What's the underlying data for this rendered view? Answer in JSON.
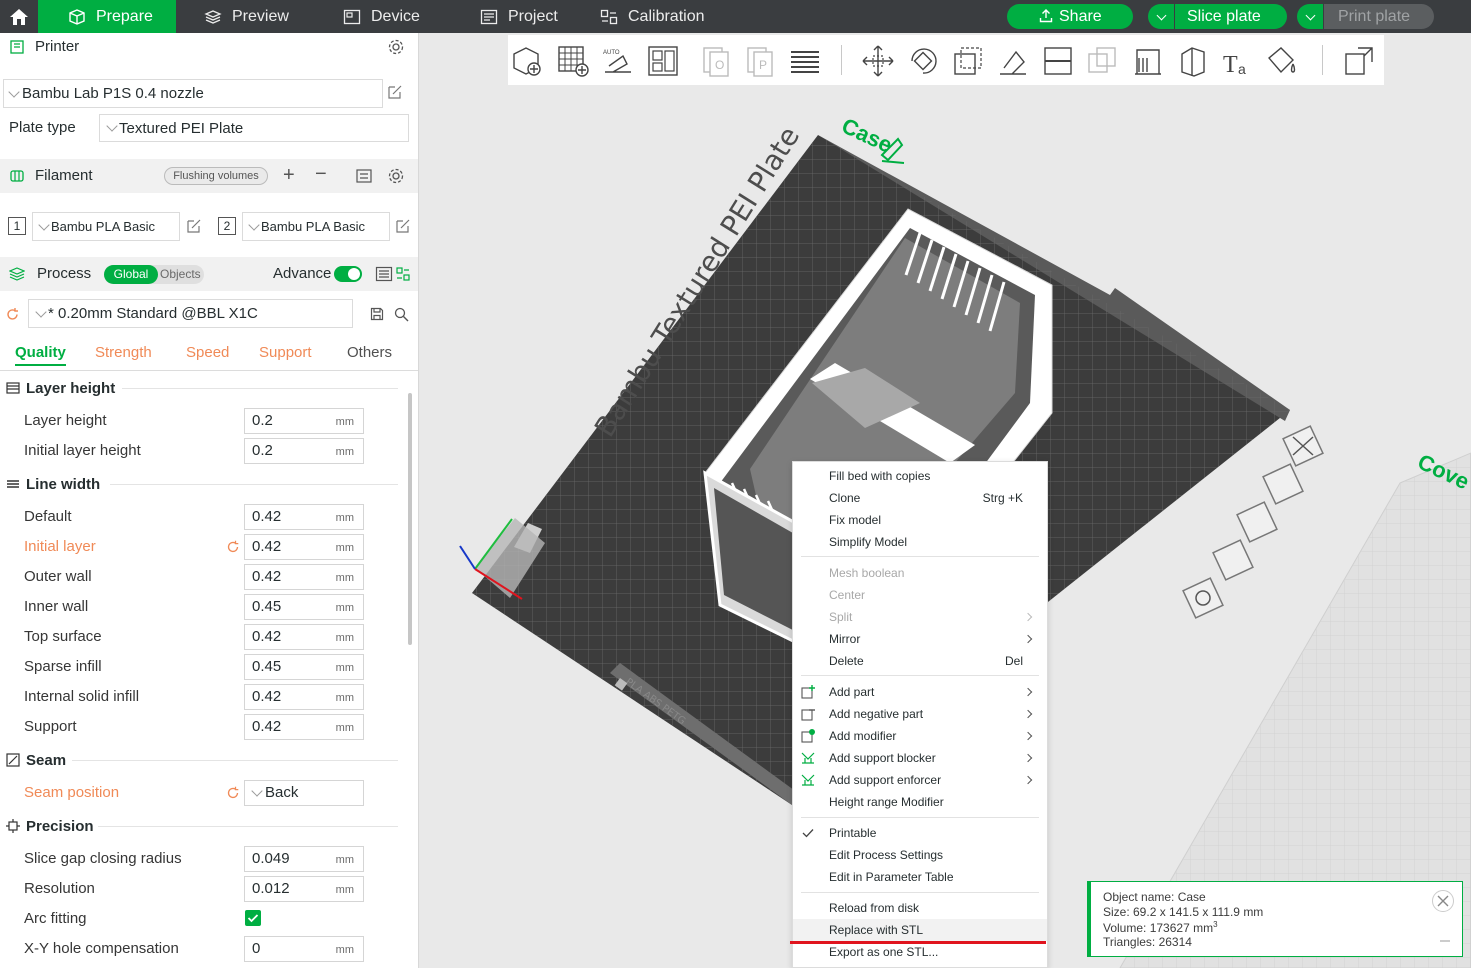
{
  "topbar": {
    "tabs": [
      "Prepare",
      "Preview",
      "Device",
      "Project",
      "Calibration"
    ],
    "share_label": "Share",
    "slice_label": "Slice plate",
    "print_label": "Print plate"
  },
  "printer": {
    "section_label": "Printer",
    "name": "Bambu Lab P1S 0.4 nozzle",
    "plate_type_label": "Plate type",
    "plate_type": "Textured PEI Plate"
  },
  "filament": {
    "section_label": "Filament",
    "flushing_label": "Flushing volumes",
    "slots": [
      {
        "index": "1",
        "name": "Bambu PLA Basic"
      },
      {
        "index": "2",
        "name": "Bambu PLA Basic"
      }
    ]
  },
  "process": {
    "section_label": "Process",
    "global_label": "Global",
    "objects_label": "Objects",
    "advance_label": "Advance",
    "preset": "* 0.20mm Standard @BBL X1C",
    "tabs": [
      "Quality",
      "Strength",
      "Speed",
      "Support",
      "Others"
    ]
  },
  "groups": {
    "layer_height": {
      "title": "Layer height",
      "options": [
        {
          "label": "Layer height",
          "value": "0.2",
          "unit": "mm"
        },
        {
          "label": "Initial layer height",
          "value": "0.2",
          "unit": "mm"
        }
      ]
    },
    "line_width": {
      "title": "Line width",
      "options": [
        {
          "label": "Default",
          "value": "0.42",
          "unit": "mm"
        },
        {
          "label": "Initial layer",
          "value": "0.42",
          "unit": "mm"
        },
        {
          "label": "Outer wall",
          "value": "0.42",
          "unit": "mm"
        },
        {
          "label": "Inner wall",
          "value": "0.45",
          "unit": "mm"
        },
        {
          "label": "Top surface",
          "value": "0.42",
          "unit": "mm"
        },
        {
          "label": "Sparse infill",
          "value": "0.45",
          "unit": "mm"
        },
        {
          "label": "Internal solid infill",
          "value": "0.42",
          "unit": "mm"
        },
        {
          "label": "Support",
          "value": "0.42",
          "unit": "mm"
        }
      ]
    },
    "seam": {
      "title": "Seam",
      "position_label": "Seam position",
      "position_value": "Back"
    },
    "precision": {
      "title": "Precision",
      "options": [
        {
          "label": "Slice gap closing radius",
          "value": "0.049",
          "unit": "mm"
        },
        {
          "label": "Resolution",
          "value": "0.012",
          "unit": "mm"
        },
        {
          "label": "Arc fitting",
          "value": "",
          "unit": ""
        },
        {
          "label": "X-Y hole compensation",
          "value": "0",
          "unit": "mm"
        }
      ]
    }
  },
  "viewport": {
    "plate_text": "Bambu Textured PEI Plate",
    "plate_tag": "PLA ABS PETG",
    "case_label": "Case",
    "cover_label": "Cove"
  },
  "context_menu": {
    "items": [
      {
        "label": "Fill bed with copies",
        "shortcut": ""
      },
      {
        "label": "Clone",
        "shortcut": "Strg +K"
      },
      {
        "label": "Fix model",
        "shortcut": ""
      },
      {
        "label": "Simplify Model",
        "shortcut": ""
      },
      {
        "label": "Mesh boolean",
        "shortcut": ""
      },
      {
        "label": "Center",
        "shortcut": ""
      },
      {
        "label": "Split",
        "shortcut": ""
      },
      {
        "label": "Mirror",
        "shortcut": ""
      },
      {
        "label": "Delete",
        "shortcut": "Del"
      },
      {
        "label": "Add part",
        "shortcut": ""
      },
      {
        "label": "Add negative part",
        "shortcut": ""
      },
      {
        "label": "Add modifier",
        "shortcut": ""
      },
      {
        "label": "Add support blocker",
        "shortcut": ""
      },
      {
        "label": "Add support enforcer",
        "shortcut": ""
      },
      {
        "label": "Height range Modifier",
        "shortcut": ""
      },
      {
        "label": "Printable",
        "shortcut": ""
      },
      {
        "label": "Edit Process Settings",
        "shortcut": ""
      },
      {
        "label": "Edit in Parameter Table",
        "shortcut": ""
      },
      {
        "label": "Reload from disk",
        "shortcut": ""
      },
      {
        "label": "Replace with STL",
        "shortcut": ""
      },
      {
        "label": "Export as one STL...",
        "shortcut": ""
      }
    ]
  },
  "object_info": {
    "name": "Object name: Case",
    "size": "Size: 69.2 x 141.5 x 111.9 mm",
    "volume": "Volume: 173627 mm",
    "volume_sup": "3",
    "triangles": "Triangles: 26314"
  },
  "colors": {
    "accent": "#00ae42",
    "modified": "#f08a57",
    "topbar": "#3a3d40",
    "highlight_line": "#e0141e"
  }
}
